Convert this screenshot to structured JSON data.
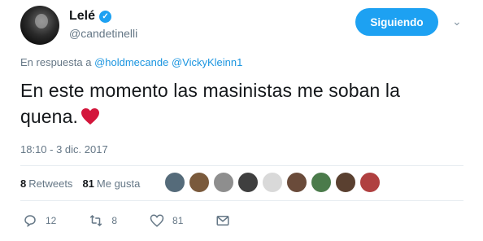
{
  "author": {
    "name": "Lelé",
    "handle": "@candetinelli",
    "verified_icon": "verified-badge-icon"
  },
  "follow_button": {
    "label": "Siguiendo"
  },
  "reply_to": {
    "prefix": "En respuesta a",
    "mentions": [
      "@holdmecande",
      "@VickyKleinn1"
    ]
  },
  "tweet": {
    "text": "En este momento las masinistas me soban la quena.",
    "emoji": "red-heart-icon"
  },
  "timestamp": "18:10 - 3 dic. 2017",
  "stats": {
    "retweets_count": "8",
    "retweets_label": "Retweets",
    "likes_count": "81",
    "likes_label": "Me gusta"
  },
  "likers": [
    "#556b7a",
    "#7a5a3c",
    "#8e8e8e",
    "#3f3f3f",
    "#d9d9d9",
    "#6a4b3a",
    "#4b7b4b",
    "#5a4030",
    "#b04040"
  ],
  "actions": {
    "reply_count": "12",
    "retweet_count": "8",
    "like_count": "81"
  },
  "colors": {
    "accent": "#1da1f2",
    "heart": "#e0245e",
    "muted": "#657786"
  }
}
